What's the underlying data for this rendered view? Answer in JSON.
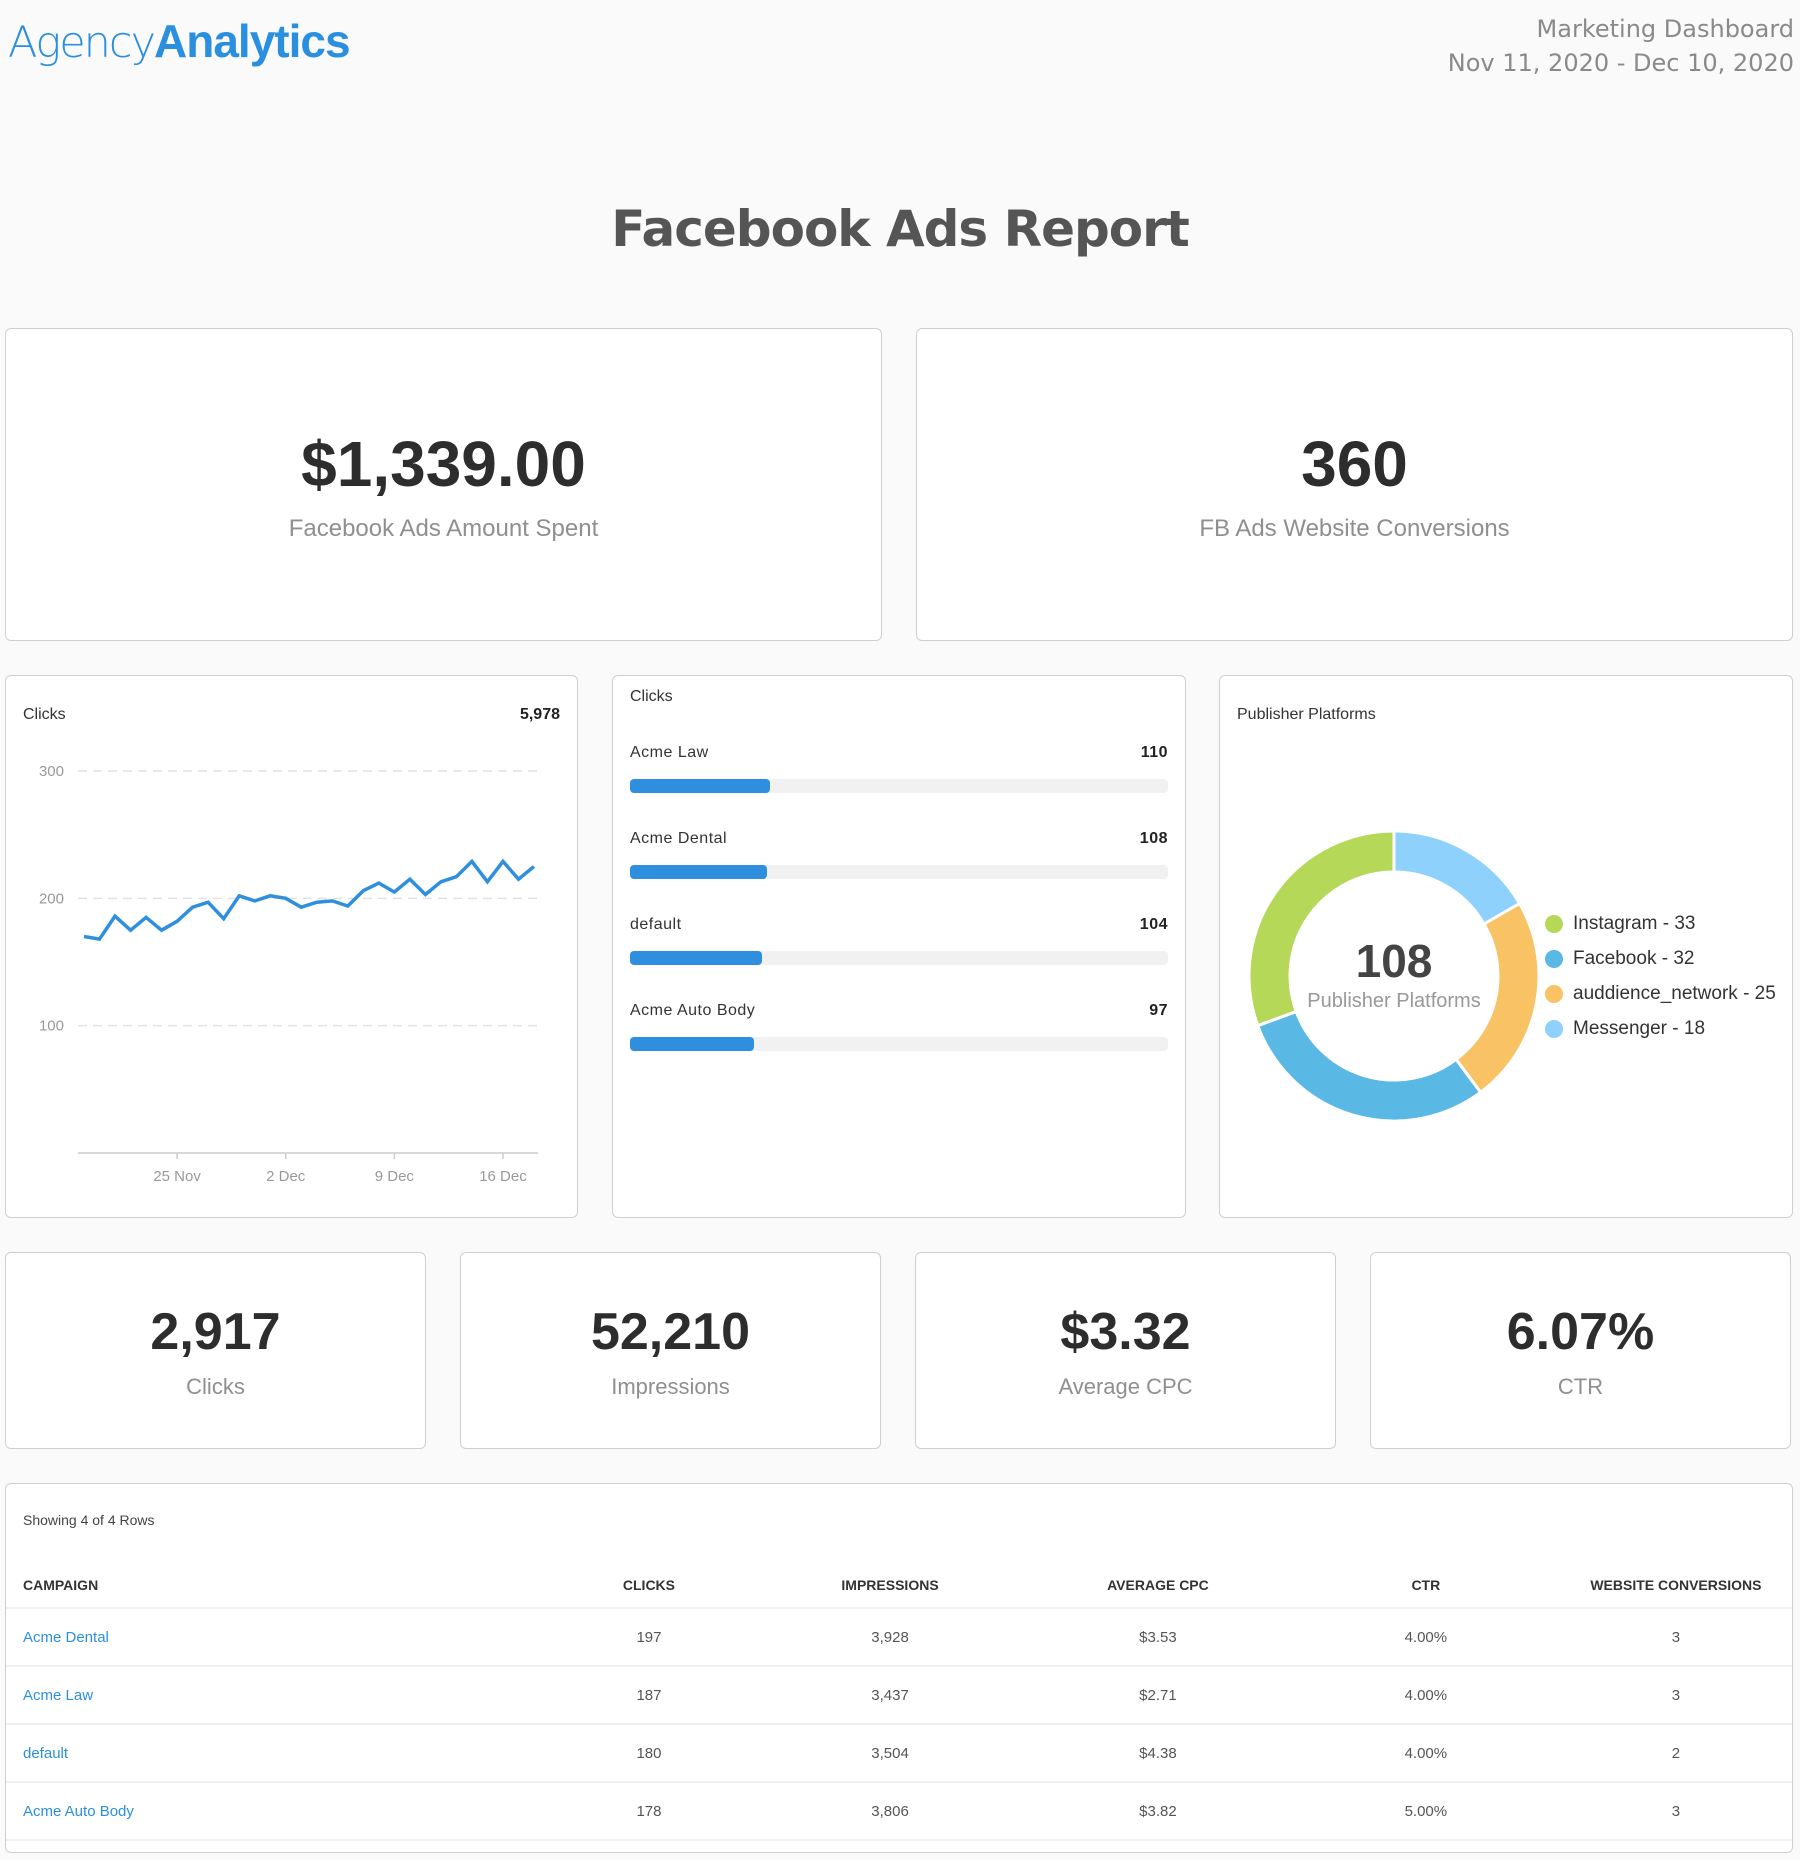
{
  "header": {
    "logo_part1": "Agency",
    "logo_part2": "Analytics",
    "dashboard_name": "Marketing Dashboard",
    "date_range": "Nov 11, 2020 - Dec 10, 2020"
  },
  "report_title": "Facebook Ads Report",
  "top_kpis": [
    {
      "value": "$1,339.00",
      "label": "Facebook Ads Amount Spent"
    },
    {
      "value": "360",
      "label": "FB Ads Website Conversions"
    }
  ],
  "bottom_kpis": [
    {
      "value": "2,917",
      "label": "Clicks"
    },
    {
      "value": "52,210",
      "label": "Impressions"
    },
    {
      "value": "$3.32",
      "label": "Average CPC"
    },
    {
      "value": "6.07%",
      "label": "CTR"
    }
  ],
  "campaign_bars": {
    "title": "Clicks",
    "items": [
      {
        "label": "Acme Law",
        "value": "110",
        "fill_fraction": 0.26
      },
      {
        "label": "Acme Dental",
        "value": "108",
        "fill_fraction": 0.255
      },
      {
        "label": "default",
        "value": "104",
        "fill_fraction": 0.245
      },
      {
        "label": "Acme Auto Body",
        "value": "97",
        "fill_fraction": 0.23
      }
    ],
    "color": "#2f8fdf"
  },
  "table": {
    "showing": "Showing 4 of 4 Rows",
    "columns": [
      "CAMPAIGN",
      "CLICKS",
      "IMPRESSIONS",
      "AVERAGE CPC",
      "CTR",
      "WEBSITE CONVERSIONS"
    ],
    "rows": [
      [
        "Acme Dental",
        "197",
        "3,928",
        "$3.53",
        "4.00%",
        "3"
      ],
      [
        "Acme Law",
        "187",
        "3,437",
        "$2.71",
        "4.00%",
        "3"
      ],
      [
        "default",
        "180",
        "3,504",
        "$4.38",
        "4.00%",
        "2"
      ],
      [
        "Acme Auto Body",
        "178",
        "3,806",
        "$3.82",
        "5.00%",
        "3"
      ]
    ]
  },
  "chart_data": [
    {
      "type": "line",
      "title": "Clicks",
      "total": "5,978",
      "xlabel": "",
      "ylabel": "",
      "ylim": [
        0,
        300
      ],
      "yticks": [
        100,
        200,
        300
      ],
      "ytick_labels": [
        "100",
        "200",
        "300"
      ],
      "xtick_labels": [
        "25 Nov",
        "2 Dec",
        "9 Dec",
        "16 Dec"
      ],
      "xtick_indices": [
        6,
        13,
        20,
        27
      ],
      "grid": true,
      "color": "#2f8fdf",
      "series": [
        {
          "name": "Clicks",
          "values": [
            170,
            168,
            186,
            175,
            185,
            175,
            182,
            193,
            197,
            184,
            202,
            198,
            202,
            200,
            193,
            197,
            198,
            194,
            206,
            212,
            205,
            215,
            203,
            213,
            217,
            229,
            213,
            229,
            215,
            225
          ]
        }
      ]
    },
    {
      "type": "pie",
      "title": "Publisher Platforms",
      "center_value": "108",
      "center_label": "Publisher Platforms",
      "legend_position": "right",
      "slices": [
        {
          "label": "Instagram",
          "value": 33,
          "legend": "Instagram - 33",
          "color": "#b5d858"
        },
        {
          "label": "Facebook",
          "value": 32,
          "legend": "Facebook - 32",
          "color": "#5ab8e4"
        },
        {
          "label": "auddience_network",
          "value": 25,
          "legend": "auddience_network - 25",
          "color": "#f8c265"
        },
        {
          "label": "Messenger",
          "value": 18,
          "legend": "Messenger - 18",
          "color": "#8dd1fc"
        }
      ]
    }
  ]
}
